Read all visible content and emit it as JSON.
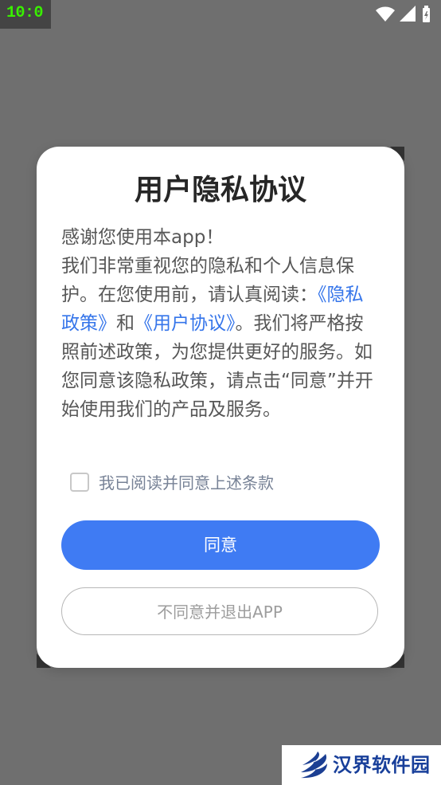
{
  "status_bar": {
    "time": "10:0"
  },
  "dialog": {
    "title": "用户隐私协议",
    "body": {
      "line1": "感谢您使用本app！",
      "part1": "我们非常重视您的隐私和个人信息保护。在您使用前，请认真阅读：",
      "privacy_link": "《隐私政策》",
      "part2": "和",
      "agreement_link": "《用户协议》",
      "part3": "。我们将严格按照前述政策，为您提供更好的服务。如您同意该隐私政策，请点击“同意”并开始使用我们的产品及服务。"
    },
    "checkbox_label": "我已阅读并同意上述条款",
    "agree_label": "同意",
    "disagree_label": "不同意并退出APP"
  },
  "watermark": {
    "text": "汉界软件园"
  },
  "colors": {
    "overlay": "#6f6f6f",
    "primary_button": "#3f7bf3",
    "link": "#3575ea",
    "title": "#262626",
    "body": "#575757",
    "watermark_text": "#183f9a"
  },
  "icons": [
    "wifi-icon",
    "signal-icon",
    "battery-icon",
    "watermark-logo-icon"
  ]
}
